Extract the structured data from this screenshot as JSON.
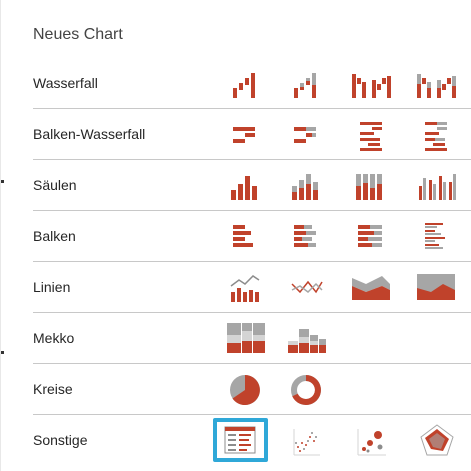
{
  "dialog": {
    "title": "Neues Chart"
  },
  "rows": [
    {
      "label": "Wasserfall",
      "icons": [
        "waterfall-icon",
        "waterfall-stacked-icon",
        "waterfall-clustered-icon",
        "waterfall-clustered-stacked-icon"
      ]
    },
    {
      "label": "Balken-Wasserfall",
      "icons": [
        "bar-waterfall-icon",
        "bar-waterfall-stacked-icon",
        "bar-waterfall-clustered-icon",
        "bar-waterfall-clustered-stacked-icon"
      ]
    },
    {
      "label": "Säulen",
      "icons": [
        "column-icon",
        "column-stacked-icon",
        "column-100-icon",
        "column-clustered-icon"
      ]
    },
    {
      "label": "Balken",
      "icons": [
        "bar-icon",
        "bar-stacked-icon",
        "bar-100-icon",
        "bar-clustered-icon"
      ]
    },
    {
      "label": "Linien",
      "icons": [
        "line-column-icon",
        "line-icon",
        "area-icon",
        "area-100-icon"
      ]
    },
    {
      "label": "Mekko",
      "icons": [
        "mekko-icon",
        "mekko-stacked-icon"
      ]
    },
    {
      "label": "Kreise",
      "icons": [
        "pie-icon",
        "doughnut-icon"
      ]
    },
    {
      "label": "Sonstige",
      "icons": [
        "table-icon",
        "scatter-icon",
        "bubble-icon",
        "radar-icon"
      ],
      "selected_icon": "table-icon"
    }
  ],
  "colors": {
    "accent_red": "#c0422b",
    "accent_gray": "#a6a6a6",
    "selection_border": "#2fa8d8",
    "row_divider": "#c8c8c8"
  }
}
